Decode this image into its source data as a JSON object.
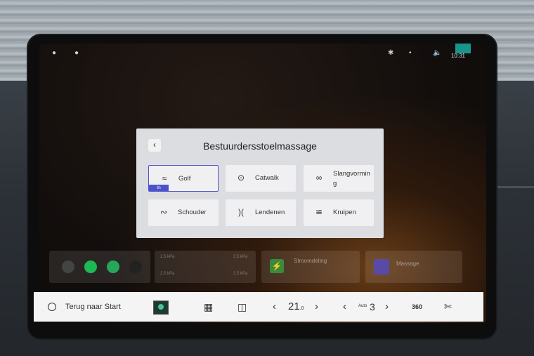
{
  "status_bar": {
    "time": "10:31",
    "icons": [
      "person-icon",
      "microphone-icon",
      "bluetooth-icon",
      "signal-icon",
      "volume-icon"
    ]
  },
  "dialog": {
    "title": "Bestuurdersstoelmassage",
    "back_icon": "chevron-left-icon",
    "options": [
      {
        "label": "Golf",
        "icon": "wave-icon",
        "active": true,
        "tag": "In"
      },
      {
        "label": "Catwalk",
        "icon": "target-icon",
        "active": false
      },
      {
        "label": "Slangvorming",
        "icon": "infinity-icon",
        "active": false
      },
      {
        "label": "Schouder",
        "icon": "curves-icon",
        "active": false
      },
      {
        "label": "Lendenen",
        "icon": "brackets-icon",
        "active": false
      },
      {
        "label": "Kruipen",
        "icon": "crawl-icon",
        "active": false
      }
    ]
  },
  "background_widgets": {
    "tires": [
      "2.5 kPa",
      "2.5 kPa",
      "2.5 kPa",
      "2.5 kPa"
    ],
    "power": "Stroomdeling",
    "massage": "Massage"
  },
  "bottom_bar": {
    "home_label": "Terug naar Start",
    "temperature": "21",
    "temperature_decimal": ".0",
    "fan_label": "Auto",
    "fan_level": "3",
    "camera_label": "360"
  }
}
